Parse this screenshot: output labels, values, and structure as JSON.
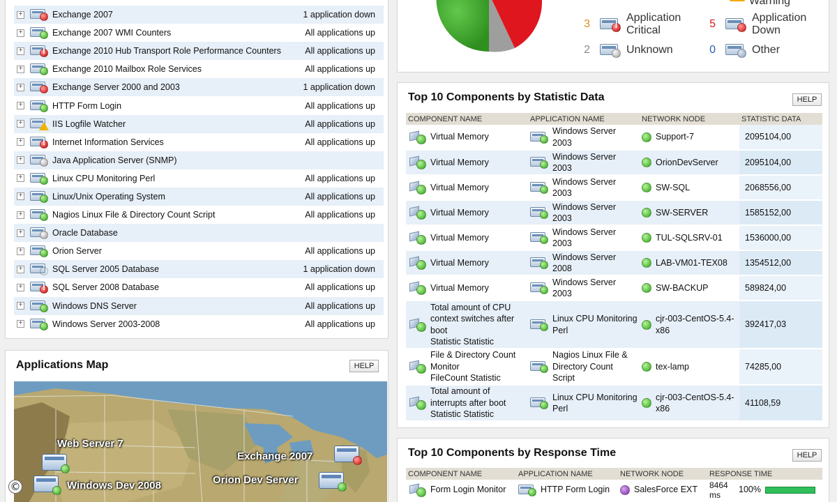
{
  "app_list": {
    "rows": [
      {
        "name": "Exchange 2007",
        "status": "1 application down",
        "icon": "down"
      },
      {
        "name": "Exchange 2007 WMI Counters",
        "status": "All applications up",
        "icon": "up"
      },
      {
        "name": "Exchange 2010 Hub Transport Role Performance Counters",
        "status": "All applications up",
        "icon": "critical"
      },
      {
        "name": "Exchange 2010 Mailbox Role Services",
        "status": "All applications up",
        "icon": "up"
      },
      {
        "name": "Exchange Server 2000 and 2003",
        "status": "1 application down",
        "icon": "down"
      },
      {
        "name": "HTTP Form Login",
        "status": "All applications up",
        "icon": "up"
      },
      {
        "name": "IIS Logfile Watcher",
        "status": "All applications up",
        "icon": "warning"
      },
      {
        "name": "Internet Information Services",
        "status": "All applications up",
        "icon": "critical"
      },
      {
        "name": "Java Application Server (SNMP)",
        "status": "",
        "icon": "unknown"
      },
      {
        "name": "Linux CPU Monitoring Perl",
        "status": "All applications up",
        "icon": "up"
      },
      {
        "name": "Linux/Unix Operating System",
        "status": "All applications up",
        "icon": "up"
      },
      {
        "name": "Nagios Linux File & Directory Count Script",
        "status": "All applications up",
        "icon": "up"
      },
      {
        "name": "Oracle Database",
        "status": "",
        "icon": "unknown"
      },
      {
        "name": "Orion Server",
        "status": "All applications up",
        "icon": "up"
      },
      {
        "name": "SQL Server 2005 Database",
        "status": "1 application down",
        "icon": "yellow"
      },
      {
        "name": "SQL Server 2008 Database",
        "status": "All applications up",
        "icon": "critical"
      },
      {
        "name": "Windows DNS Server",
        "status": "All applications up",
        "icon": "up"
      },
      {
        "name": "Windows Server 2003-2008",
        "status": "All applications up",
        "icon": "up"
      }
    ]
  },
  "applications_map": {
    "title": "Applications Map",
    "help_label": "HELP",
    "nodes": [
      {
        "label": "Web Server 7",
        "status": "up"
      },
      {
        "label": "Windows Dev 2008",
        "status": "up"
      },
      {
        "label": "Exchange 2007",
        "status": "down"
      },
      {
        "label": "Orion Dev Server",
        "status": "up"
      }
    ]
  },
  "status_summary": {
    "legend": [
      {
        "count": "",
        "label": "Warning",
        "icon": "warning",
        "count_color": "#e08a1e"
      },
      {
        "count": "3",
        "label": "Application Critical",
        "icon": "critical",
        "count_color": "#e08a1e"
      },
      {
        "count": "5",
        "label": "Application Down",
        "icon": "down",
        "count_color": "#d11a1a"
      },
      {
        "count": "2",
        "label": "Unknown",
        "icon": "unknown",
        "count_color": "#888888"
      },
      {
        "count": "0",
        "label": "Other",
        "icon": "other",
        "count_color": "#2b5fae"
      }
    ],
    "pie_colors": {
      "up": "#3faa2b",
      "down": "#e0161e",
      "unknown": "#9e9e9e",
      "warning": "#f2a900"
    }
  },
  "top_stat": {
    "title": "Top 10 Components by Statistic Data",
    "help_label": "HELP",
    "columns": [
      "COMPONENT NAME",
      "APPLICATION NAME",
      "NETWORK NODE",
      "STATISTIC DATA"
    ],
    "rows": [
      {
        "component": "Virtual Memory",
        "application": "Windows Server 2003",
        "node": "Support-7",
        "value": "2095104,00"
      },
      {
        "component": "Virtual Memory",
        "application": "Windows Server 2003",
        "node": "OrionDevServer",
        "value": "2095104,00"
      },
      {
        "component": "Virtual Memory",
        "application": "Windows Server 2003",
        "node": "SW-SQL",
        "value": "2068556,00"
      },
      {
        "component": "Virtual Memory",
        "application": "Windows Server 2003",
        "node": "SW-SERVER",
        "value": "1585152,00"
      },
      {
        "component": "Virtual Memory",
        "application": "Windows Server 2003",
        "node": "TUL-SQLSRV-01",
        "value": "1536000,00"
      },
      {
        "component": "Virtual Memory",
        "application": "Windows Server 2008",
        "node": "LAB-VM01-TEX08",
        "value": "1354512,00"
      },
      {
        "component": "Virtual Memory",
        "application": "Windows Server 2003",
        "node": "SW-BACKUP",
        "value": "589824,00"
      },
      {
        "component": "Total amount of CPU context switches after boot",
        "component_sub": "Statistic Statistic",
        "application": "Linux CPU Monitoring Perl",
        "node": "cjr-003-CentOS-5.4-x86",
        "value": "392417,03"
      },
      {
        "component": "File & Directory Count Monitor",
        "component_sub": "FileCount Statistic",
        "application": "Nagios Linux File & Directory Count Script",
        "node": "tex-lamp",
        "value": "74285,00"
      },
      {
        "component": "Total amount of interrupts after boot",
        "component_sub": "Statistic Statistic",
        "application": "Linux CPU Monitoring Perl",
        "node": "cjr-003-CentOS-5.4-x86",
        "value": "41108,59"
      }
    ]
  },
  "top_response": {
    "title": "Top 10 Components by Response Time",
    "help_label": "HELP",
    "columns": [
      "COMPONENT NAME",
      "APPLICATION NAME",
      "NETWORK NODE",
      "RESPONSE TIME"
    ],
    "rows": [
      {
        "component": "Form Login Monitor",
        "application": "HTTP Form Login",
        "node": "SalesForce EXT",
        "time": "8464 ms",
        "percent": "100%",
        "fill": 1.0
      }
    ]
  },
  "copyright_symbol": "©"
}
